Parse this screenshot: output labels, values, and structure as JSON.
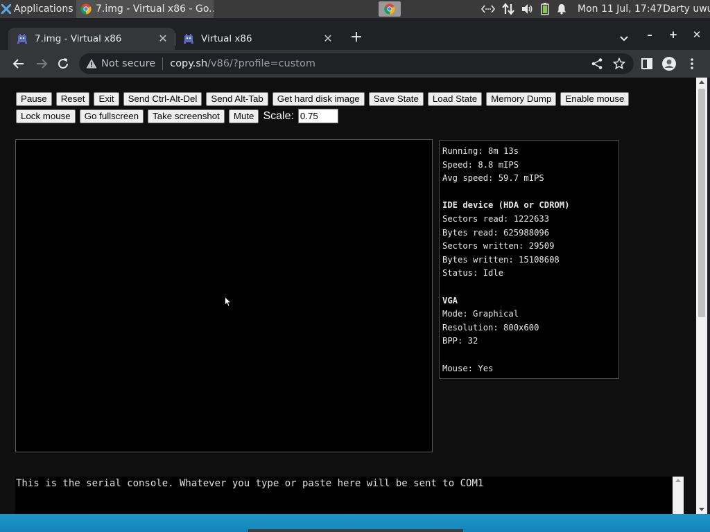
{
  "panel": {
    "applications_label": "Applications",
    "task_title": "7.img - Virtual x86 - Go...",
    "clock": "Mon 11 Jul, 17:47",
    "user": "Darty uwu",
    "tray_icons": [
      "network-code-icon",
      "transfer-arrows-icon",
      "volume-icon",
      "battery-icon",
      "bell-icon"
    ]
  },
  "browser": {
    "tabs": [
      {
        "title": "7.img - Virtual x86",
        "active": true
      },
      {
        "title": "Virtual x86",
        "active": false
      }
    ],
    "address": {
      "security_label": "Not secure",
      "host": "copy.sh",
      "path": "/v86/?profile=custom"
    }
  },
  "controls": {
    "row1": [
      "Pause",
      "Reset",
      "Exit",
      "Send Ctrl-Alt-Del",
      "Send Alt-Tab",
      "Get hard disk image",
      "Save State",
      "Load State",
      "Memory Dump",
      "Enable mouse"
    ],
    "row2": [
      "Lock mouse",
      "Go fullscreen",
      "Take screenshot",
      "Mute"
    ],
    "scale_label": "Scale:",
    "scale_value": "0.75"
  },
  "stats": {
    "running": "Running: 8m 13s",
    "speed": "Speed: 8.8 mIPS",
    "avg_speed": "Avg speed: 59.7 mIPS",
    "ide_header": "IDE device (HDA or CDROM)",
    "sectors_read": "Sectors read: 1222633",
    "bytes_read": "Bytes read: 625988096",
    "sectors_written": "Sectors written: 29509",
    "bytes_written": "Bytes written: 15108608",
    "ide_status": "Status: Idle",
    "vga_header": "VGA",
    "vga_mode": "Mode: Graphical",
    "vga_resolution": "Resolution: 800x600",
    "vga_bpp": "BPP: 32",
    "mouse": "Mouse: Yes"
  },
  "serial": {
    "text": "This is the serial console. Whatever you type or paste here will be sent to COM1"
  },
  "colors": {
    "page_bg": "#0f0f0f",
    "chrome_dark": "#202124",
    "chrome_toolbar": "#35363a",
    "desktop_blue": "#1d95c8"
  }
}
